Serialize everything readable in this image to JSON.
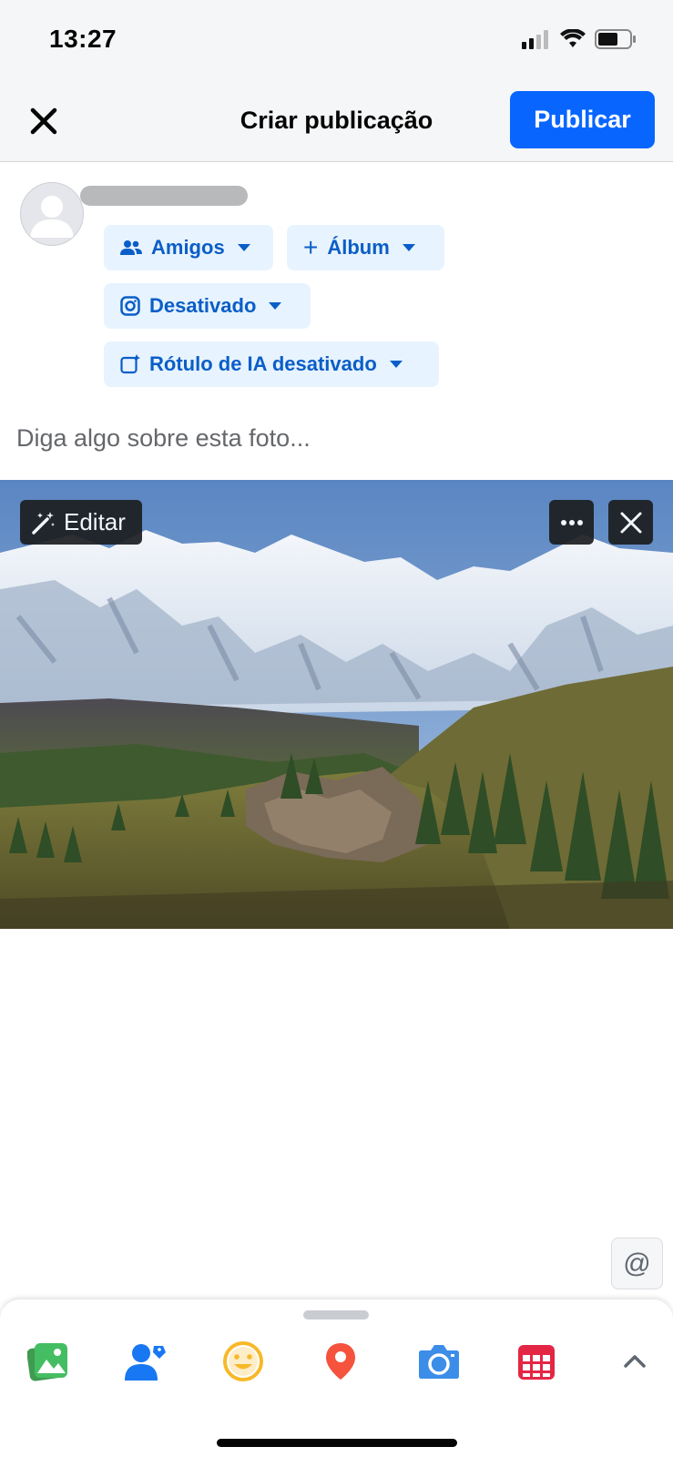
{
  "status_bar": {
    "time": "13:27"
  },
  "header": {
    "title": "Criar publicação",
    "publish_label": "Publicar"
  },
  "audience_chips": {
    "friends": "Amigos",
    "album": "Álbum",
    "instagram": "Desativado",
    "ai_label": "Rótulo de IA desativado"
  },
  "composer": {
    "placeholder": "Diga algo sobre esta foto..."
  },
  "photo_actions": {
    "edit_label": "Editar"
  },
  "mention": {
    "symbol": "@"
  },
  "tray_icons": [
    "photo-icon",
    "tag-people-icon",
    "feeling-icon",
    "location-icon",
    "camera-icon",
    "event-icon",
    "chevron-up-icon"
  ],
  "colors": {
    "primary": "#0866ff",
    "chip_bg": "#e7f3ff",
    "chip_text": "#0a5ec7"
  }
}
